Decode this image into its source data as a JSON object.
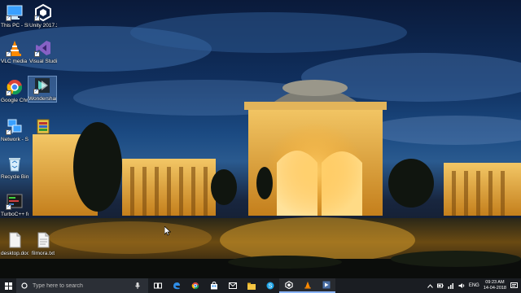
{
  "desktop": {
    "icons": [
      {
        "label": "This PC - Shortcut",
        "icon": "this-pc-icon"
      },
      {
        "label": "Unity 2017.2.0...",
        "icon": "unity-icon"
      },
      {
        "label": "VLC media player",
        "icon": "vlc-icon"
      },
      {
        "label": "Visual Studio 2017",
        "icon": "visual-studio-icon"
      },
      {
        "label": "Google Chrome",
        "icon": "chrome-icon"
      },
      {
        "label": "Wondershare Filmora",
        "icon": "filmora-icon"
      },
      {
        "label": "Network - Shortcut",
        "icon": "network-icon"
      },
      {
        "label": "",
        "icon": "archive-file-icon"
      },
      {
        "label": "Recycle Bin",
        "icon": "recycle-bin-icon"
      },
      {
        "label": "TurboC++ for Windo...",
        "icon": "turbo-cpp-icon"
      },
      {
        "label": "desktop.docx",
        "icon": "document-icon"
      },
      {
        "label": "filmora.txt",
        "icon": "text-file-icon"
      }
    ]
  },
  "taskbar": {
    "search_placeholder": "Type here to search",
    "apps": [
      "task-view-icon",
      "edge-icon",
      "chrome-icon",
      "store-icon",
      "mail-icon",
      "file-explorer-icon",
      "skype-icon",
      "unity-icon",
      "vlc-icon",
      "app-icon"
    ],
    "tray": {
      "language": "ENG",
      "time": "09:23 AM",
      "date": "14-04-2018"
    }
  },
  "colors": {
    "taskbar_bg": "#1a1d22",
    "search_bg": "#2b2f36",
    "accent": "#8ab4f8"
  }
}
